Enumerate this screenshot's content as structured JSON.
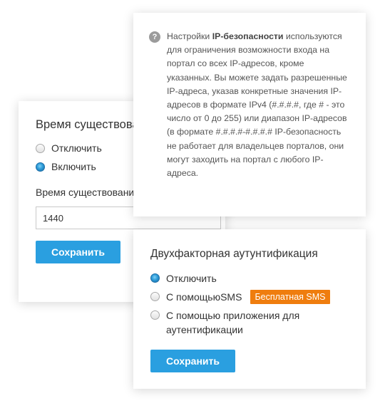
{
  "session": {
    "title": "Время существования сессии",
    "options": [
      {
        "label": "Отключить",
        "checked": false
      },
      {
        "label": "Включить",
        "checked": true
      }
    ],
    "field_label": "Время существования сессии",
    "field_value": "1440",
    "save_label": "Сохранить"
  },
  "ip_security": {
    "icon": "question-circle-icon",
    "lead": "Настройки ",
    "bold": "IP-безопасности",
    "text": " используются для ограничения возможности входа на портал со всех IP-адресов, кроме указанных. Вы можете задать разрешенные IP-адреса, указав конкретные значения IP-адресов в формате IPv4 (#.#.#.#, где # - это число от 0 до 255) или диапазон IP-адресов (в формате #.#.#.#-#.#.#.# IP-безопасность не работает для владельцев порталов, они могут заходить на портал с любого IP-адреса."
  },
  "two_factor": {
    "title": "Двухфакторная аутунтификация",
    "options": [
      {
        "label": "Отключить",
        "checked": true
      },
      {
        "label": "С помощьюSMS",
        "checked": false
      },
      {
        "label": "С помощью приложения для аутентификации",
        "checked": false
      }
    ],
    "sms_badge": "Бесплатная SMS",
    "save_label": "Сохранить"
  },
  "colors": {
    "accent": "#2a9fe0",
    "badge": "#ef7d0e"
  }
}
